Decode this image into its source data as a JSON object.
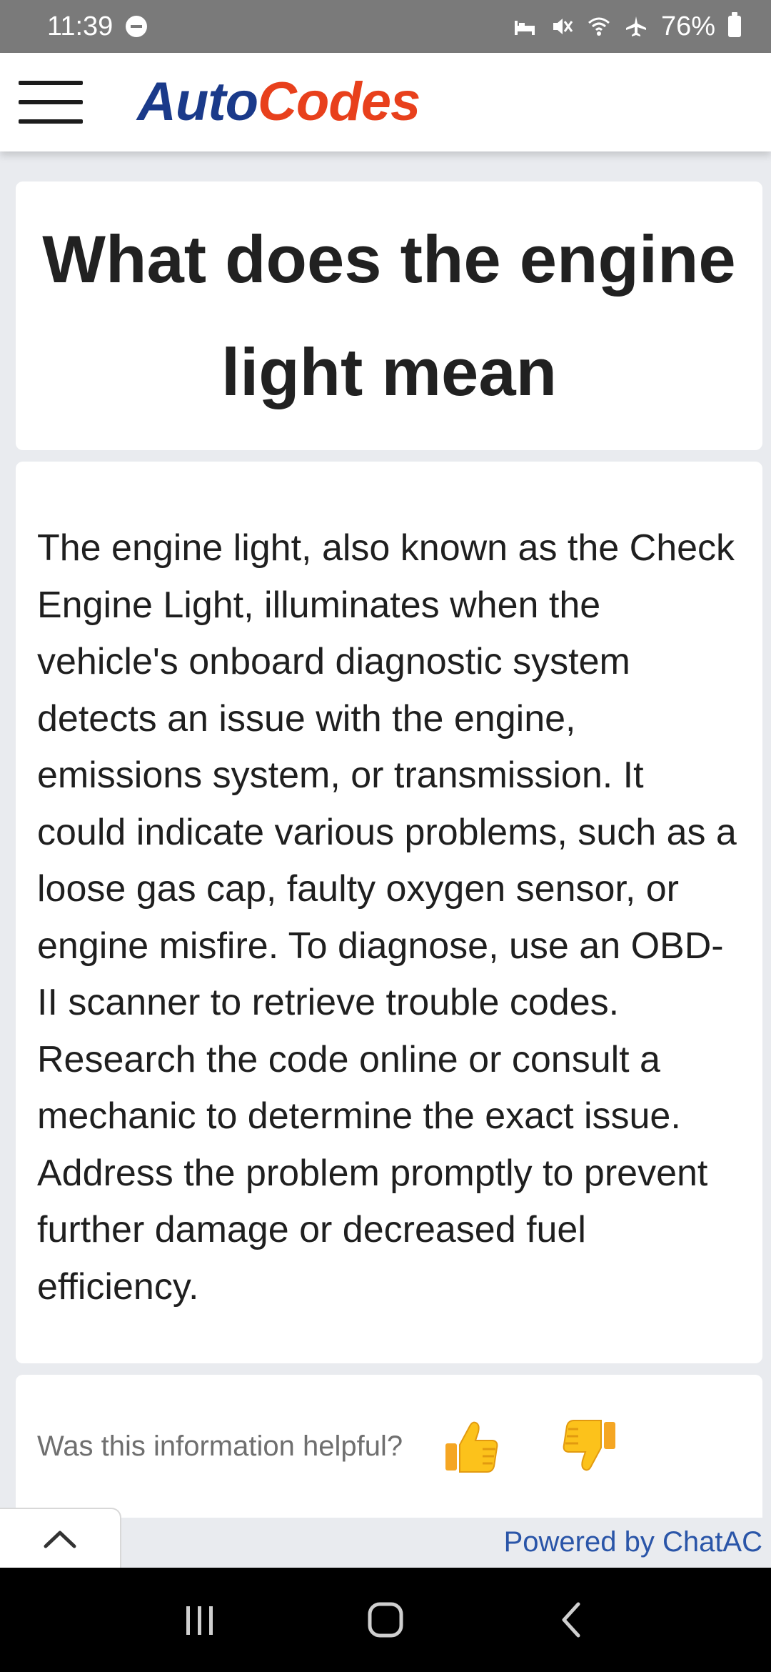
{
  "status_bar": {
    "time": "11:39",
    "battery": "76%"
  },
  "header": {
    "logo_part1": "Auto",
    "logo_part2": "Codes",
    "brand_colors": {
      "blue": "#1a3a8a",
      "orange": "#e8401c"
    }
  },
  "article": {
    "title": "What does the engine light mean",
    "body": "The engine light, also known as the Check Engine Light, illuminates when the vehicle's onboard diagnostic system detects an issue with the engine, emissions system, or transmission. It could indicate various problems, such as a loose gas cap, faulty oxygen sensor, or engine misfire. To diagnose, use an OBD-II scanner to retrieve trouble codes. Research the code online or consult a mechanic to determine the exact issue. Address the problem promptly to prevent further damage or decreased fuel efficiency."
  },
  "feedback": {
    "prompt": "Was this information helpful?",
    "thumbs_up_icon": "thumbs-up-icon",
    "thumbs_down_icon": "thumbs-down-icon"
  },
  "footer": {
    "powered_by": "Powered by ChatAC"
  }
}
